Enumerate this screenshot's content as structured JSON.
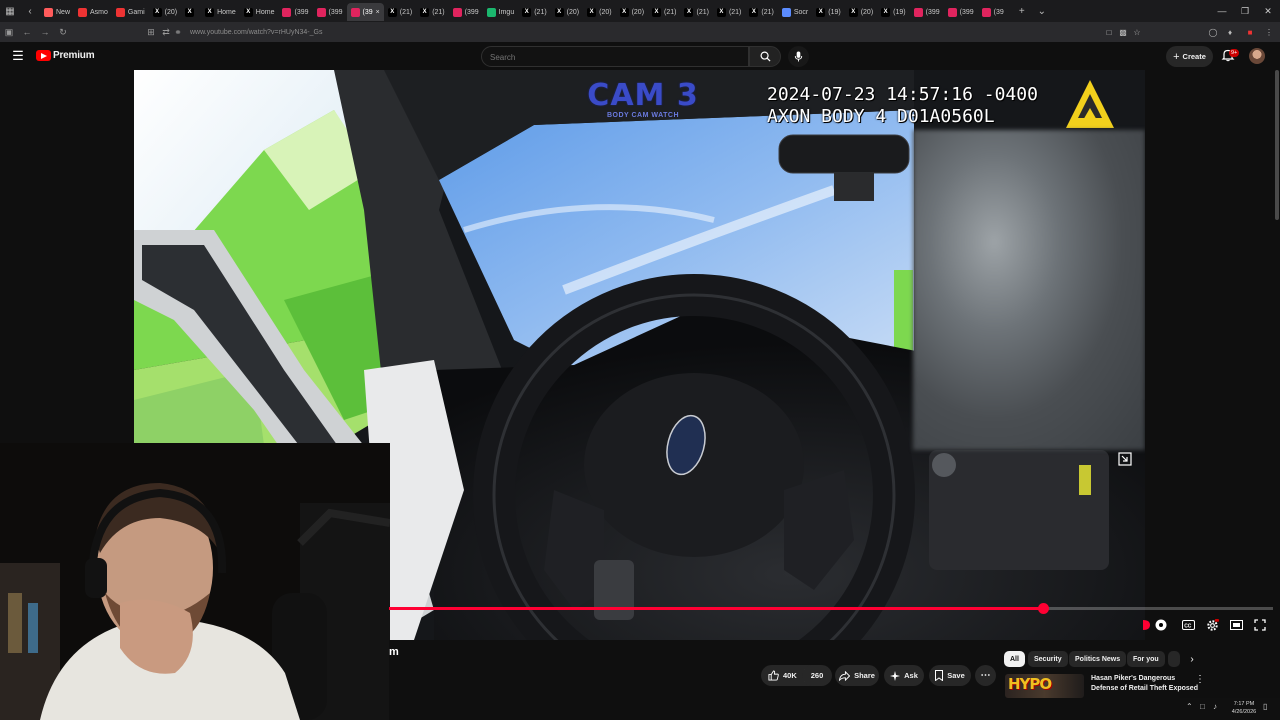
{
  "browser": {
    "tabs": [
      {
        "label": "New",
        "color": "#ff5b5b",
        "glyph": ""
      },
      {
        "label": "Asmo",
        "color": "#e33",
        "glyph": ""
      },
      {
        "label": "Gami",
        "color": "#e33",
        "glyph": ""
      },
      {
        "label": "(20)",
        "color": "#000",
        "glyph": "X"
      },
      {
        "label": "",
        "color": "#000",
        "glyph": "X"
      },
      {
        "label": "Home",
        "color": "#000",
        "glyph": "X"
      },
      {
        "label": "Home",
        "color": "#000",
        "glyph": "X"
      },
      {
        "label": "(399",
        "color": "#e0245e",
        "glyph": ""
      },
      {
        "label": "(399",
        "color": "#e0245e",
        "glyph": ""
      },
      {
        "label": "(39",
        "color": "#e0245e",
        "glyph": "",
        "active": true
      },
      {
        "label": "(21)",
        "color": "#000",
        "glyph": "X"
      },
      {
        "label": "(21)",
        "color": "#000",
        "glyph": "X"
      },
      {
        "label": "(399",
        "color": "#e0245e",
        "glyph": ""
      },
      {
        "label": "Imgu",
        "color": "#1bb76e",
        "glyph": ""
      },
      {
        "label": "(21)",
        "color": "#000",
        "glyph": "X"
      },
      {
        "label": "(20)",
        "color": "#000",
        "glyph": "X"
      },
      {
        "label": "(20)",
        "color": "#000",
        "glyph": "X"
      },
      {
        "label": "(20)",
        "color": "#000",
        "glyph": "X"
      },
      {
        "label": "(21)",
        "color": "#000",
        "glyph": "X"
      },
      {
        "label": "(21)",
        "color": "#000",
        "glyph": "X"
      },
      {
        "label": "(21)",
        "color": "#000",
        "glyph": "X"
      },
      {
        "label": "(21)",
        "color": "#000",
        "glyph": "X"
      },
      {
        "label": "Socr",
        "color": "#5b8cff",
        "glyph": ""
      },
      {
        "label": "(19)",
        "color": "#000",
        "glyph": "X"
      },
      {
        "label": "(20)",
        "color": "#000",
        "glyph": "X"
      },
      {
        "label": "(19)",
        "color": "#000",
        "glyph": "X"
      },
      {
        "label": "(399",
        "color": "#e0245e",
        "glyph": ""
      },
      {
        "label": "(399",
        "color": "#e0245e",
        "glyph": ""
      },
      {
        "label": "(39",
        "color": "#e0245e",
        "glyph": ""
      }
    ],
    "url": "www.youtube.com/watch?v=rHUyN34-_Gs"
  },
  "header": {
    "brand": "Premium",
    "search_placeholder": "Search",
    "create_label": "Create",
    "notifications_badge": "9+"
  },
  "video": {
    "cam_title": "CAM 3",
    "cam_subtitle": "BODY CAM WATCH",
    "timestamp_line1": "2024-07-23 14:57:16 -0400",
    "timestamp_line2": "AXON BODY 4 D01A0560L",
    "progress": 0.74
  },
  "below": {
    "title_fragment": "m",
    "like_count": "40K",
    "comment_count": "260",
    "share_label": "Share",
    "ask_label": "Ask",
    "save_label": "Save"
  },
  "chips": [
    "All",
    "Security",
    "Politics News",
    "For you"
  ],
  "recommendation": {
    "thumb_text": "HYPO",
    "title": "Hasan Piker's Dangerous Defense of Retail Theft Exposed"
  },
  "taskbar": {
    "time": "7:17 PM",
    "date": "4/26/2026"
  },
  "colors": {
    "accent": "#ff0000",
    "progress": "#ff0033",
    "background": "#0f0f0f"
  }
}
